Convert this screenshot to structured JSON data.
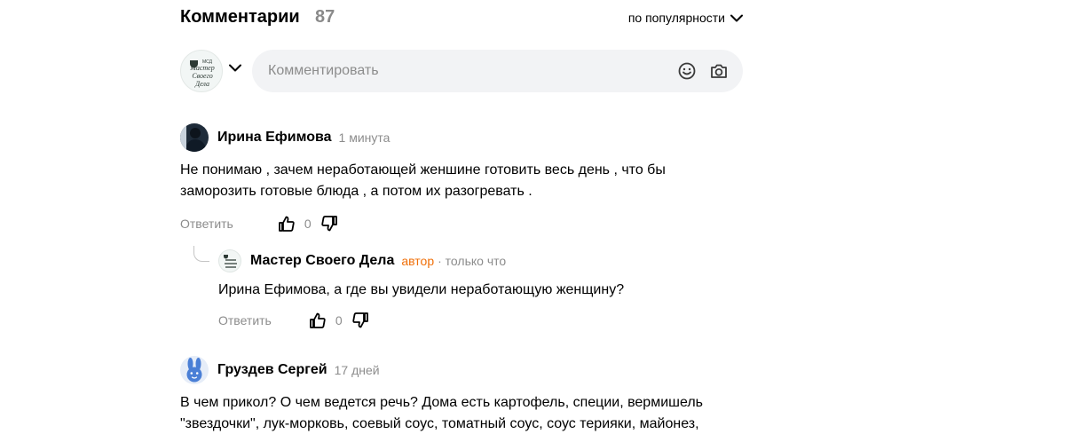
{
  "header": {
    "title": "Комментарии",
    "count": "87",
    "sort_label": "по популярности"
  },
  "composer": {
    "placeholder": "Комментировать",
    "avatar_text": [
      "МСД",
      "Мастер",
      "Своего",
      "Дела"
    ]
  },
  "comments": [
    {
      "author": "Ирина Ефимова",
      "time": "1 минута",
      "text_lines": [
        "Не понимаю , зачем неработающей женшине готовить весь день , что бы",
        "заморозить готовые блюда , а потом их разогревать ."
      ],
      "reply_label": "Ответить",
      "likes": "0"
    },
    {
      "author": "Мастер Своего Дела",
      "badge": "автор",
      "time": "· только что",
      "text": "Ирина Ефимова, а где вы увидели неработающую женщину?",
      "reply_label": "Ответить",
      "likes": "0"
    },
    {
      "author": "Груздев Сергей",
      "time": "17 дней",
      "text_lines": [
        "В чем прикол? О чем ведется речь? Дома есть картофель, специи, вермишель",
        "\"звездочки\", лук-морковь, соевый соус, томатный соус, соус терияки, майонез,"
      ]
    }
  ],
  "colors": {
    "muted": "#8c8c8c",
    "author_badge": "#f0700a",
    "input_bg": "#f2f3f5",
    "bunny_avatar": "#4a7fd6"
  }
}
